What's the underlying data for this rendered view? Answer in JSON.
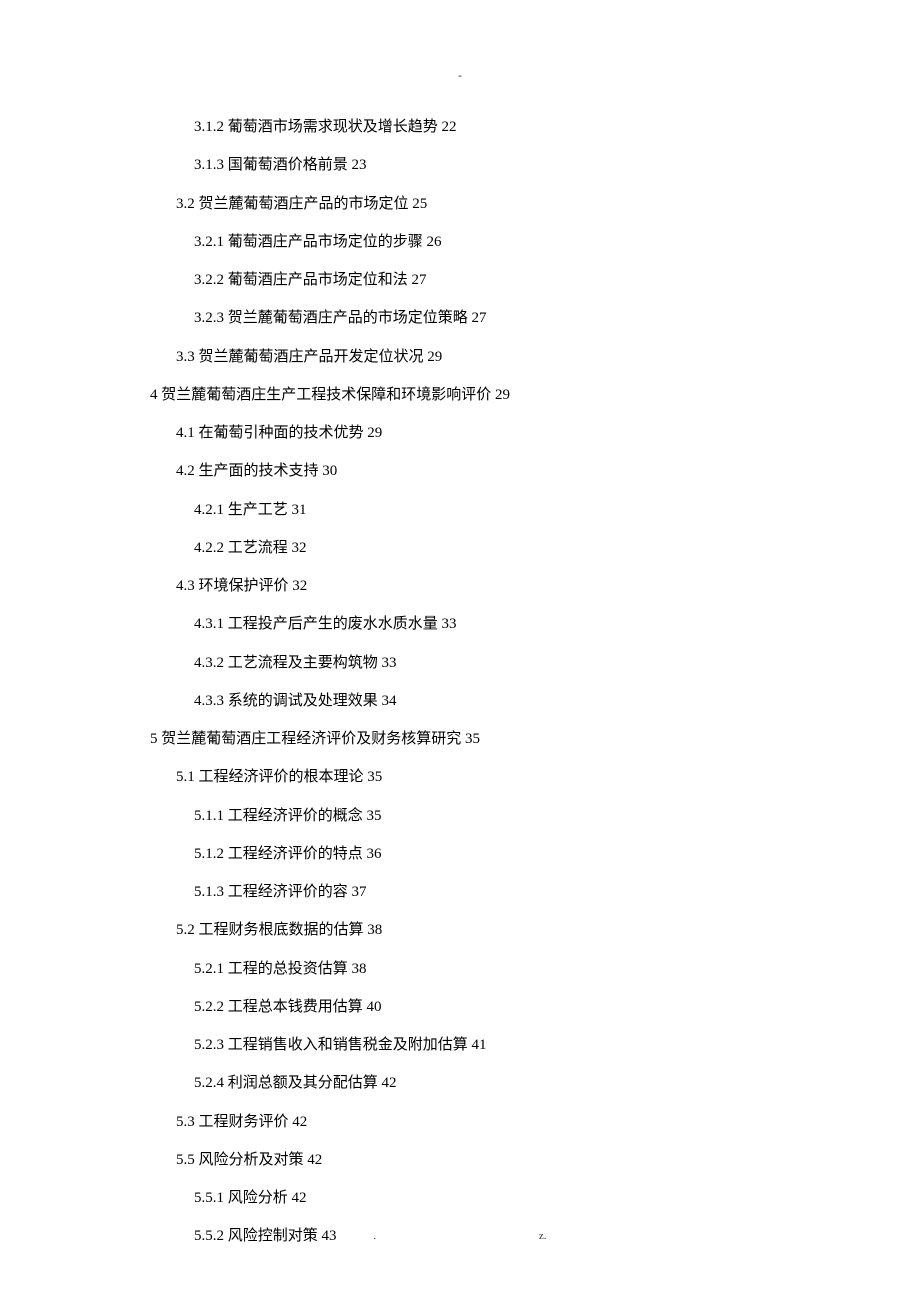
{
  "header_mark": "-",
  "toc": [
    {
      "level": 3,
      "text": "3.1.2 葡萄酒市场需求现状及增长趋势 22"
    },
    {
      "level": 3,
      "text": "3.1.3 国葡萄酒价格前景 23"
    },
    {
      "level": 2,
      "text": "3.2 贺兰麓葡萄酒庄产品的市场定位 25"
    },
    {
      "level": 3,
      "text": "3.2.1 葡萄酒庄产品市场定位的步骤 26"
    },
    {
      "level": 3,
      "text": "3.2.2 葡萄酒庄产品市场定位和法 27"
    },
    {
      "level": 3,
      "text": "3.2.3 贺兰麓葡萄酒庄产品的市场定位策略 27"
    },
    {
      "level": 2,
      "text": "3.3 贺兰麓葡萄酒庄产品开发定位状况 29"
    },
    {
      "level": 1,
      "text": "4 贺兰麓葡萄酒庄生产工程技术保障和环境影响评价 29"
    },
    {
      "level": 2,
      "text": "4.1 在葡萄引种面的技术优势 29"
    },
    {
      "level": 2,
      "text": "4.2 生产面的技术支持 30"
    },
    {
      "level": 3,
      "text": "4.2.1 生产工艺 31"
    },
    {
      "level": 3,
      "text": "4.2.2 工艺流程 32"
    },
    {
      "level": 2,
      "text": "4.3 环境保护评价 32"
    },
    {
      "level": 3,
      "text": "4.3.1 工程投产后产生的废水水质水量 33"
    },
    {
      "level": 3,
      "text": "4.3.2 工艺流程及主要构筑物 33"
    },
    {
      "level": 3,
      "text": "4.3.3 系统的调试及处理效果 34"
    },
    {
      "level": 1,
      "text": "5 贺兰麓葡萄酒庄工程经济评价及财务核算研究 35"
    },
    {
      "level": 2,
      "text": "5.1 工程经济评价的根本理论 35"
    },
    {
      "level": 3,
      "text": "5.1.1 工程经济评价的概念 35"
    },
    {
      "level": 3,
      "text": "5.1.2 工程经济评价的特点 36"
    },
    {
      "level": 3,
      "text": "5.1.3 工程经济评价的容 37"
    },
    {
      "level": 2,
      "text": "5.2 工程财务根底数据的估算 38"
    },
    {
      "level": 3,
      "text": "5.2.1 工程的总投资估算 38"
    },
    {
      "level": 3,
      "text": "5.2.2 工程总本钱费用估算 40"
    },
    {
      "level": 3,
      "text": "5.2.3 工程销售收入和销售税金及附加估算 41"
    },
    {
      "level": 3,
      "text": "5.2.4 利润总额及其分配估算 42"
    },
    {
      "level": 2,
      "text": "5.3 工程财务评价 42"
    },
    {
      "level": 2,
      "text": "5.5 风险分析及对策 42"
    },
    {
      "level": 3,
      "text": "5.5.1 风险分析 42"
    },
    {
      "level": 3,
      "text": "5.5.2 风险控制对策 43"
    }
  ],
  "footer": {
    "dot": ".",
    "z": "z."
  }
}
